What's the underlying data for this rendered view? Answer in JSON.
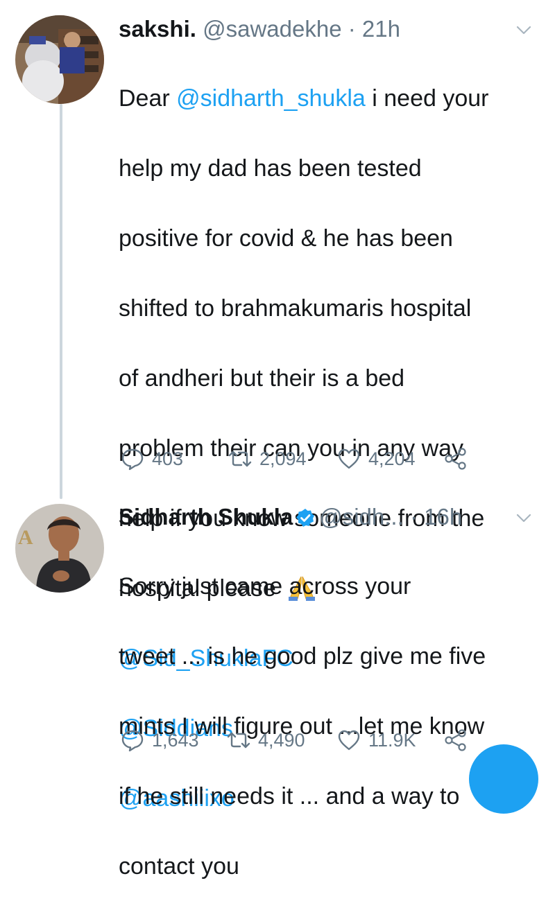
{
  "tweet1": {
    "name": "sakshi.",
    "handle": "@sawadekhe",
    "dot": "·",
    "time": "21h",
    "lines": [
      {
        "pre": "Dear ",
        "mention": "@sidharth_shukla",
        "post": " i need your"
      },
      {
        "text": "help my dad has been tested"
      },
      {
        "text": "positive for covid & he has been"
      },
      {
        "text": "shifted to brahmakumaris hospital"
      },
      {
        "text": "of andheri but their is a bed"
      },
      {
        "text": "problem their can you in any way"
      },
      {
        "text": "help if you know someone from the"
      },
      {
        "text": "hospital please",
        "emoji": "praying-hands-emoji"
      }
    ],
    "mentions": [
      "@Sid_ShuklaFC",
      "@Siddians",
      "@aashiiixo"
    ],
    "replies": "403",
    "retweets": "2,094",
    "likes": "4,204"
  },
  "tweet2": {
    "name": "Sidharth Shukla",
    "verified": true,
    "handle": "@sidh...",
    "dot": "·",
    "time": "16h",
    "lines": [
      "Sorry just came across your",
      "tweet ... is he good plz give me five",
      "mints  I will figure out ...let me know",
      "if he still needs it ... and a way to",
      "contact you"
    ],
    "replies": "1,643",
    "retweets": "4,490",
    "likes": "11.9K"
  },
  "colors": {
    "link": "#1da1f2",
    "muted": "#657786",
    "text": "#14171a",
    "thread_line": "#ccd6dd"
  },
  "icons": {
    "reply": "speech-bubble-icon",
    "retweet": "retweet-arrows-icon",
    "like": "heart-outline-icon",
    "share": "share-nodes-icon",
    "menu": "chevron-down-icon",
    "verified": "verified-badge-icon"
  }
}
